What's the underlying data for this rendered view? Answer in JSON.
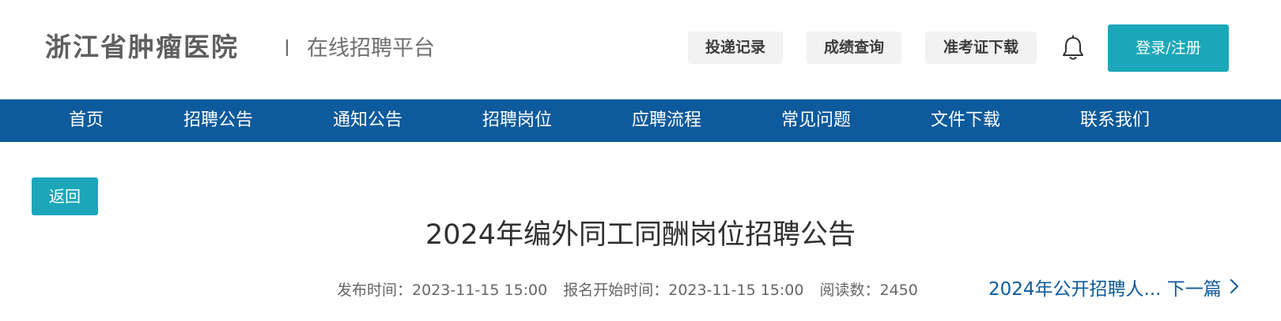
{
  "header": {
    "logo_text": "浙江省肿瘤医院",
    "subtitle": "在线招聘平台",
    "buttons": [
      {
        "label": "投递记录"
      },
      {
        "label": "成绩查询"
      },
      {
        "label": "准考证下载"
      }
    ],
    "bell_icon": "bell-icon",
    "login_label": "登录/注册"
  },
  "nav": {
    "items": [
      {
        "label": "首页"
      },
      {
        "label": "招聘公告"
      },
      {
        "label": "通知公告"
      },
      {
        "label": "招聘岗位"
      },
      {
        "label": "应聘流程"
      },
      {
        "label": "常见问题"
      },
      {
        "label": "文件下载"
      },
      {
        "label": "联系我们"
      }
    ]
  },
  "article": {
    "back_label": "返回",
    "title": "2024年编外同工同酬岗位招聘公告",
    "publish_label": "发布时间：",
    "publish_time": "2023-11-15 15:00",
    "signup_label": "报名开始时间：",
    "signup_time": "2023-11-15 15:00",
    "reads_label": "阅读数：",
    "reads": "2450",
    "next_title": "2024年公开招聘人...",
    "next_label": "下一篇",
    "next_icon": "chevron-right-icon"
  },
  "colors": {
    "nav_bg": "#0d5a9c",
    "accent": "#1ba7b9",
    "link": "#0d5a9c"
  }
}
